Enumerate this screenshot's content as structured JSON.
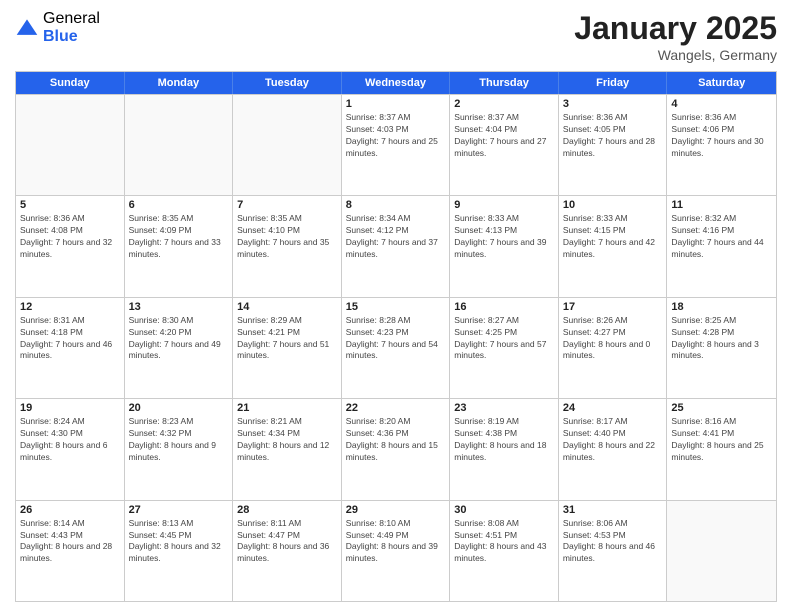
{
  "header": {
    "logo_general": "General",
    "logo_blue": "Blue",
    "title": "January 2025",
    "subtitle": "Wangels, Germany"
  },
  "days": [
    "Sunday",
    "Monday",
    "Tuesday",
    "Wednesday",
    "Thursday",
    "Friday",
    "Saturday"
  ],
  "weeks": [
    [
      {
        "day": "",
        "sunrise": "",
        "sunset": "",
        "daylight": ""
      },
      {
        "day": "",
        "sunrise": "",
        "sunset": "",
        "daylight": ""
      },
      {
        "day": "",
        "sunrise": "",
        "sunset": "",
        "daylight": ""
      },
      {
        "day": "1",
        "sunrise": "Sunrise: 8:37 AM",
        "sunset": "Sunset: 4:03 PM",
        "daylight": "Daylight: 7 hours and 25 minutes."
      },
      {
        "day": "2",
        "sunrise": "Sunrise: 8:37 AM",
        "sunset": "Sunset: 4:04 PM",
        "daylight": "Daylight: 7 hours and 27 minutes."
      },
      {
        "day": "3",
        "sunrise": "Sunrise: 8:36 AM",
        "sunset": "Sunset: 4:05 PM",
        "daylight": "Daylight: 7 hours and 28 minutes."
      },
      {
        "day": "4",
        "sunrise": "Sunrise: 8:36 AM",
        "sunset": "Sunset: 4:06 PM",
        "daylight": "Daylight: 7 hours and 30 minutes."
      }
    ],
    [
      {
        "day": "5",
        "sunrise": "Sunrise: 8:36 AM",
        "sunset": "Sunset: 4:08 PM",
        "daylight": "Daylight: 7 hours and 32 minutes."
      },
      {
        "day": "6",
        "sunrise": "Sunrise: 8:35 AM",
        "sunset": "Sunset: 4:09 PM",
        "daylight": "Daylight: 7 hours and 33 minutes."
      },
      {
        "day": "7",
        "sunrise": "Sunrise: 8:35 AM",
        "sunset": "Sunset: 4:10 PM",
        "daylight": "Daylight: 7 hours and 35 minutes."
      },
      {
        "day": "8",
        "sunrise": "Sunrise: 8:34 AM",
        "sunset": "Sunset: 4:12 PM",
        "daylight": "Daylight: 7 hours and 37 minutes."
      },
      {
        "day": "9",
        "sunrise": "Sunrise: 8:33 AM",
        "sunset": "Sunset: 4:13 PM",
        "daylight": "Daylight: 7 hours and 39 minutes."
      },
      {
        "day": "10",
        "sunrise": "Sunrise: 8:33 AM",
        "sunset": "Sunset: 4:15 PM",
        "daylight": "Daylight: 7 hours and 42 minutes."
      },
      {
        "day": "11",
        "sunrise": "Sunrise: 8:32 AM",
        "sunset": "Sunset: 4:16 PM",
        "daylight": "Daylight: 7 hours and 44 minutes."
      }
    ],
    [
      {
        "day": "12",
        "sunrise": "Sunrise: 8:31 AM",
        "sunset": "Sunset: 4:18 PM",
        "daylight": "Daylight: 7 hours and 46 minutes."
      },
      {
        "day": "13",
        "sunrise": "Sunrise: 8:30 AM",
        "sunset": "Sunset: 4:20 PM",
        "daylight": "Daylight: 7 hours and 49 minutes."
      },
      {
        "day": "14",
        "sunrise": "Sunrise: 8:29 AM",
        "sunset": "Sunset: 4:21 PM",
        "daylight": "Daylight: 7 hours and 51 minutes."
      },
      {
        "day": "15",
        "sunrise": "Sunrise: 8:28 AM",
        "sunset": "Sunset: 4:23 PM",
        "daylight": "Daylight: 7 hours and 54 minutes."
      },
      {
        "day": "16",
        "sunrise": "Sunrise: 8:27 AM",
        "sunset": "Sunset: 4:25 PM",
        "daylight": "Daylight: 7 hours and 57 minutes."
      },
      {
        "day": "17",
        "sunrise": "Sunrise: 8:26 AM",
        "sunset": "Sunset: 4:27 PM",
        "daylight": "Daylight: 8 hours and 0 minutes."
      },
      {
        "day": "18",
        "sunrise": "Sunrise: 8:25 AM",
        "sunset": "Sunset: 4:28 PM",
        "daylight": "Daylight: 8 hours and 3 minutes."
      }
    ],
    [
      {
        "day": "19",
        "sunrise": "Sunrise: 8:24 AM",
        "sunset": "Sunset: 4:30 PM",
        "daylight": "Daylight: 8 hours and 6 minutes."
      },
      {
        "day": "20",
        "sunrise": "Sunrise: 8:23 AM",
        "sunset": "Sunset: 4:32 PM",
        "daylight": "Daylight: 8 hours and 9 minutes."
      },
      {
        "day": "21",
        "sunrise": "Sunrise: 8:21 AM",
        "sunset": "Sunset: 4:34 PM",
        "daylight": "Daylight: 8 hours and 12 minutes."
      },
      {
        "day": "22",
        "sunrise": "Sunrise: 8:20 AM",
        "sunset": "Sunset: 4:36 PM",
        "daylight": "Daylight: 8 hours and 15 minutes."
      },
      {
        "day": "23",
        "sunrise": "Sunrise: 8:19 AM",
        "sunset": "Sunset: 4:38 PM",
        "daylight": "Daylight: 8 hours and 18 minutes."
      },
      {
        "day": "24",
        "sunrise": "Sunrise: 8:17 AM",
        "sunset": "Sunset: 4:40 PM",
        "daylight": "Daylight: 8 hours and 22 minutes."
      },
      {
        "day": "25",
        "sunrise": "Sunrise: 8:16 AM",
        "sunset": "Sunset: 4:41 PM",
        "daylight": "Daylight: 8 hours and 25 minutes."
      }
    ],
    [
      {
        "day": "26",
        "sunrise": "Sunrise: 8:14 AM",
        "sunset": "Sunset: 4:43 PM",
        "daylight": "Daylight: 8 hours and 28 minutes."
      },
      {
        "day": "27",
        "sunrise": "Sunrise: 8:13 AM",
        "sunset": "Sunset: 4:45 PM",
        "daylight": "Daylight: 8 hours and 32 minutes."
      },
      {
        "day": "28",
        "sunrise": "Sunrise: 8:11 AM",
        "sunset": "Sunset: 4:47 PM",
        "daylight": "Daylight: 8 hours and 36 minutes."
      },
      {
        "day": "29",
        "sunrise": "Sunrise: 8:10 AM",
        "sunset": "Sunset: 4:49 PM",
        "daylight": "Daylight: 8 hours and 39 minutes."
      },
      {
        "day": "30",
        "sunrise": "Sunrise: 8:08 AM",
        "sunset": "Sunset: 4:51 PM",
        "daylight": "Daylight: 8 hours and 43 minutes."
      },
      {
        "day": "31",
        "sunrise": "Sunrise: 8:06 AM",
        "sunset": "Sunset: 4:53 PM",
        "daylight": "Daylight: 8 hours and 46 minutes."
      },
      {
        "day": "",
        "sunrise": "",
        "sunset": "",
        "daylight": ""
      }
    ]
  ]
}
